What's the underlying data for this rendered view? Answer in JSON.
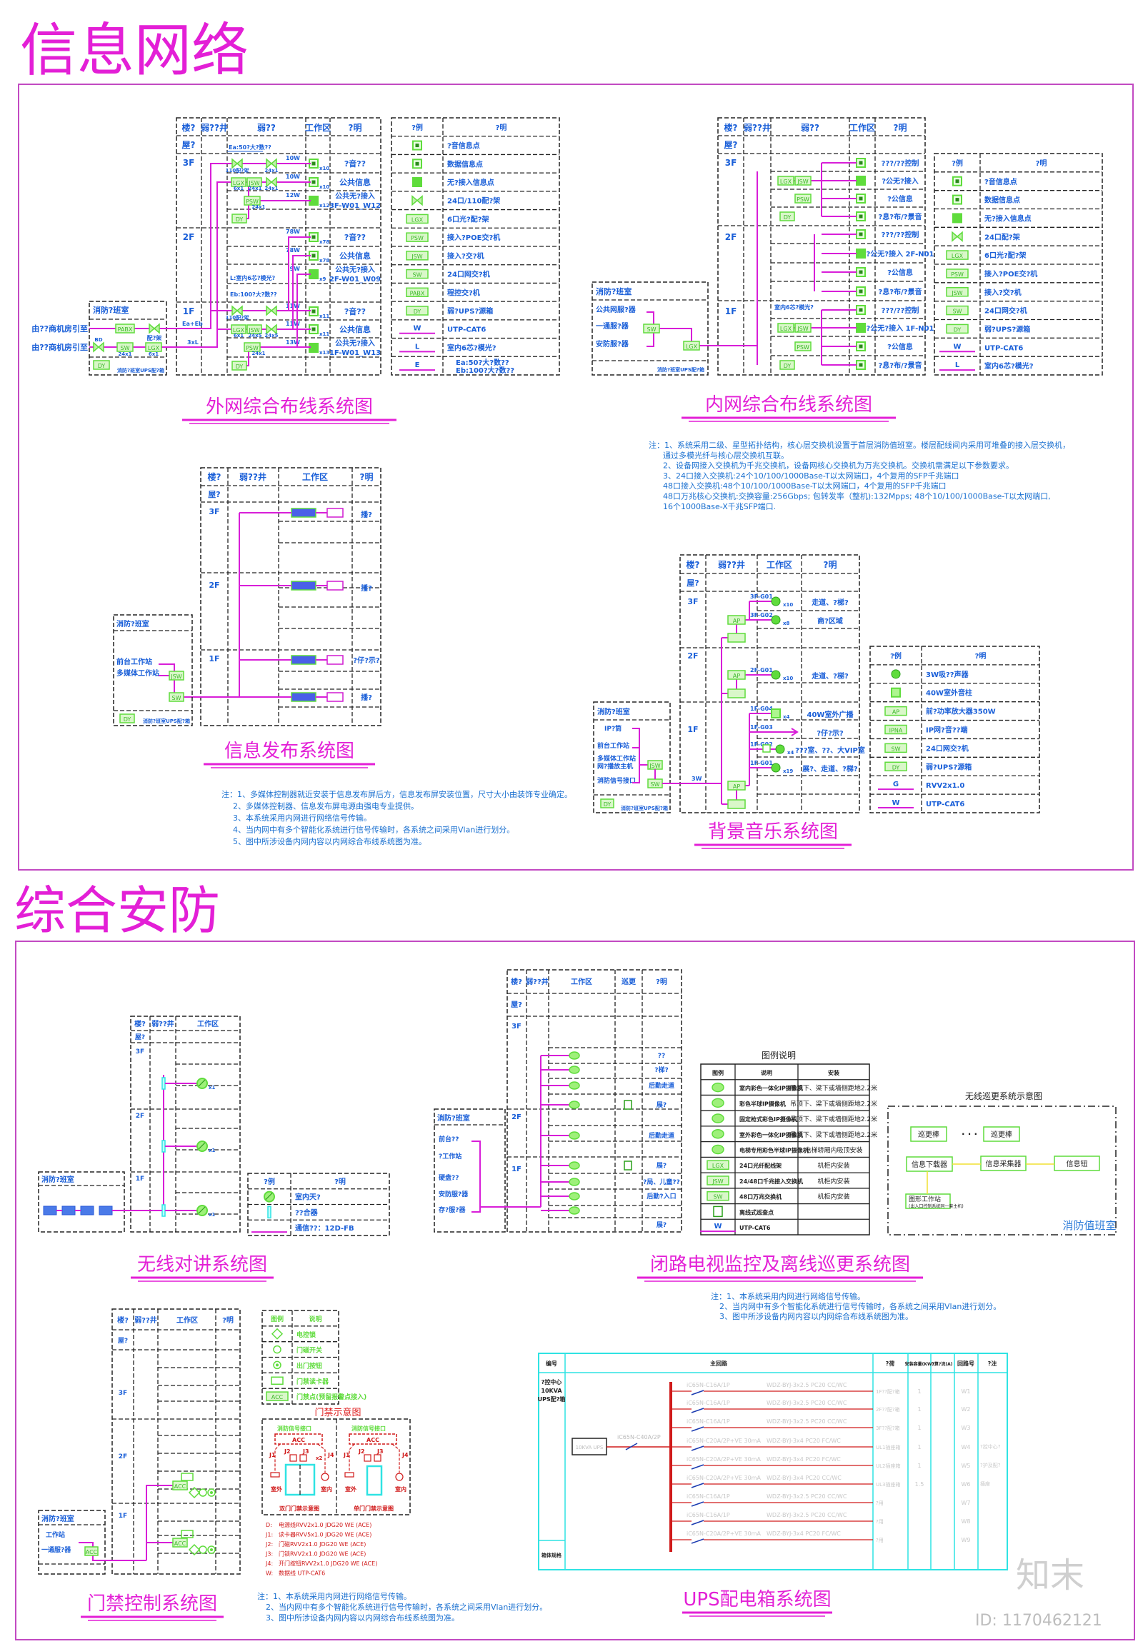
{
  "page": {
    "section1_title": "信息网络",
    "section2_title": "综合安防",
    "watermark_logo": "知末",
    "watermark_id": "ID: 1170462121"
  },
  "colors": {
    "title": "#e31fd6",
    "wire": "#d81ed8",
    "device": "#5fdc3c",
    "text": "#1a5fd8",
    "ups_bus": "#d01a1a",
    "frame": "#c24ac2"
  },
  "ext": {
    "title": "外网综合布线系统图",
    "headers": [
      "楼?",
      "弱??井",
      "弱??",
      "工作区",
      "?明"
    ],
    "floors": [
      "屋?",
      "3F",
      "2F",
      "1F"
    ],
    "desc": [
      "?音??",
      "公共信息",
      "公共无?接入",
      "3F-W01_W12",
      "?音??",
      "公共信息",
      "公共无?接入",
      "2F-W01_W09",
      "?音??",
      "公共信息",
      "公共无?接入",
      "1F-W01_W13"
    ],
    "counts": [
      "x10",
      "x10",
      "x12",
      "x78",
      "x78",
      "x9",
      "x11",
      "x11",
      "x13"
    ],
    "wires": [
      "10W",
      "10W",
      "12W",
      "78W",
      "78W",
      "9W",
      "11W",
      "11W",
      "13W"
    ],
    "room": "消防?班室",
    "ups_label": "消防?班室UPS配?箱",
    "inputs": [
      "由??商机房引至",
      "由??商机房引至"
    ],
    "cable_notes": [
      "Ea:50?大?数??",
      "L:室内6芯?模光?",
      "Eb:100?大?数??",
      "Ea+Eb",
      "3xL"
    ],
    "boxes": [
      "PABX",
      "SW",
      "LGX",
      "DY",
      "LGX",
      "JSW",
      "PSW",
      "DY",
      "LGX",
      "JSW",
      "PSW",
      "DY"
    ],
    "patch_labels": [
      "配?架",
      "BD",
      "110配?架",
      "110配?架"
    ],
    "ports": [
      "24x1",
      "6x1",
      "24x1",
      "6x1",
      "24x1",
      "24x1",
      "24x1",
      "6x1",
      "24x5",
      "24x5",
      "24x1"
    ],
    "legend": {
      "headers": [
        "?例",
        "?明"
      ],
      "items": [
        {
          "icon": "outlet",
          "label": "?音信息点"
        },
        {
          "icon": "outlet",
          "label": "数据信息点"
        },
        {
          "icon": "outlet-filled",
          "label": "无?接入信息点"
        },
        {
          "icon": "patch",
          "label": "24口/110配?架"
        },
        {
          "icon": "box",
          "code": "LGX",
          "label": "6口光?配?架"
        },
        {
          "icon": "box",
          "code": "PSW",
          "label": "接入?POE交?机"
        },
        {
          "icon": "box",
          "code": "JSW",
          "label": "接入?交?机"
        },
        {
          "icon": "box",
          "code": "SW",
          "label": "24口网交?机"
        },
        {
          "icon": "box",
          "code": "PABX",
          "label": "程控交?机"
        },
        {
          "icon": "box",
          "code": "DY",
          "label": "弱?UPS?源箱"
        },
        {
          "icon": "line",
          "code": "W",
          "label": "UTP-CAT6"
        },
        {
          "icon": "line",
          "code": "L",
          "label": "室内6芯?模光?"
        },
        {
          "icon": "line",
          "code": "E",
          "label": "Ea:50?大?数??",
          "label2": "Eb:100?大?数??"
        }
      ]
    }
  },
  "int": {
    "title": "内网综合布线系统图",
    "headers": [
      "楼?",
      "弱??井",
      "弱??",
      "工作区",
      "?明"
    ],
    "floors": [
      "屋?",
      "3F",
      "2F",
      "1F"
    ],
    "desc": [
      "???/??控制",
      "?公无?接入",
      "?公信息",
      "?息?布/?景音",
      "???/??控制",
      "?公无?接入 2F-N01",
      "?公信息",
      "?息?布/?景音",
      "???/??控制",
      "?公无?接入 1F-N01",
      "?公信息",
      "?息?布/?景音"
    ],
    "room": "消防?班室",
    "servers": [
      "公共网服?器",
      "一通服?器",
      "安防服?器"
    ],
    "ups_label": "消防?班室UPS配?箱",
    "boxes": [
      "LGX",
      "JSW",
      "PSW",
      "DY",
      "LGX",
      "JSW",
      "PSW",
      "DY",
      "SW",
      "LGX"
    ],
    "cable_note": "室内6芯?模光?",
    "legend": {
      "headers": [
        "?例",
        "?明"
      ],
      "items": [
        {
          "icon": "outlet",
          "label": "?音信息点"
        },
        {
          "icon": "outlet",
          "label": "数据信息点"
        },
        {
          "icon": "outlet-filled",
          "label": "无?接入信息点"
        },
        {
          "icon": "patch",
          "label": "24口配?架"
        },
        {
          "icon": "box",
          "code": "LGX",
          "label": "6口光?配?架"
        },
        {
          "icon": "box",
          "code": "PSW",
          "label": "接入?POE交?机"
        },
        {
          "icon": "box",
          "code": "JSW",
          "label": "接入?交?机"
        },
        {
          "icon": "box",
          "code": "SW",
          "label": "24口网交?机"
        },
        {
          "icon": "box",
          "code": "DY",
          "label": "弱?UPS?源箱"
        },
        {
          "icon": "line",
          "code": "W",
          "label": "UTP-CAT6"
        },
        {
          "icon": "line",
          "code": "L",
          "label": "室内6芯?模光?"
        }
      ]
    },
    "notes": [
      "注：1、系统采用二级、星型拓扑结构，核心层交换机设置于首层消防值班室。楼层配线间内采用可堆叠的接入层交换机，",
      "通过多模光纤与核心层交换机互联。",
      "2、设备网接入交换机为千兆交换机，设备网核心交换机为万兆交换机。交换机需满足以下参数要求。",
      "3、24口接入交换机:24个10/100/1000Base-T以太网端口，4个复用的SFP千兆端口",
      "48口接入交换机:48个10/100/1000Base-T以太网端口，4个复用的SFP千兆端口",
      "48口万兆核心交换机:交换容量:256Gbps; 包转发率（整机):132Mpps; 48个10/100/1000Base-T以太网端口,",
      "16个1000Base-X千兆SFP端口."
    ]
  },
  "pub": {
    "title": "信息发布系统图",
    "headers": [
      "楼?",
      "弱??井",
      "工作区",
      "?明"
    ],
    "floors": [
      "屋?",
      "3F",
      "2F",
      "1F"
    ],
    "desc": [
      "播?",
      "播?",
      "?仔?示?",
      "播?"
    ],
    "room": "消防?班室",
    "stations": [
      "前台工作站",
      "多媒体工作站"
    ],
    "ups_label": "消防?班室UPS配?箱",
    "boxes": [
      "JSW",
      "SW",
      "DY"
    ],
    "notes": [
      "注：1、多媒体控制器就近安装于信息发布屏后方，信息发布屏安装位置，尺寸大小由装饰专业确定。",
      "2、多媒体控制器、信息发布屏电源由强电专业提供。",
      "3、本系统采用内网进行网络信号传输。",
      "4、当内网中有多个智能化系统进行信号传输时，各系统之间采用Vlan进行划分。",
      "5、图中所涉设备内网内容以内网综合布线系统图为准。"
    ]
  },
  "music": {
    "title": "背景音乐系统图",
    "headers": [
      "楼?",
      "弱??井",
      "工作区",
      "?明"
    ],
    "floors": [
      "屋?",
      "3F",
      "2F",
      "1F"
    ],
    "zones": [
      "3F-G01",
      "3F-G02",
      "2F-G01",
      "1F-G04",
      "1F-G03",
      "1F-G02",
      "1F-G01"
    ],
    "counts": [
      "x10",
      "x8",
      "x10",
      "x4",
      "x4",
      "x19"
    ],
    "desc": [
      "走道、?梯?",
      "商?区域",
      "走道、?梯?",
      "40W室外广播",
      "?仔?示?",
      "???室、??、大VIP室",
      "展?、走道、?梯?"
    ],
    "room": "消防?班室",
    "sources": [
      "IP?筒",
      "前台工作站",
      "多媒体工作站",
      "网?播放主机",
      "消防信号接口"
    ],
    "ups_label": "消防?班室UPS配?箱",
    "boxes": [
      "JSW",
      "SW",
      "DY",
      "AP",
      "AP",
      "AP"
    ],
    "wire_note": "3W",
    "legend": {
      "headers": [
        "?例",
        "?明"
      ],
      "items": [
        {
          "icon": "speaker",
          "label": "3W吸??声器"
        },
        {
          "icon": "speaker-square",
          "label": "40W室外音柱"
        },
        {
          "icon": "box",
          "code": "AP",
          "label": "前?功率放大器350W"
        },
        {
          "icon": "box",
          "code": "IPNA",
          "label": "IP网?音??端"
        },
        {
          "icon": "box",
          "code": "SW",
          "label": "24口网交?机"
        },
        {
          "icon": "box",
          "code": "DY",
          "label": "弱?UPS?源箱"
        },
        {
          "icon": "line",
          "code": "G",
          "label": "RVV2x1.0"
        },
        {
          "icon": "line",
          "code": "W",
          "label": "UTP-CAT6"
        }
      ]
    }
  },
  "radio": {
    "title": "无线对讲系统图",
    "headers": [
      "楼?",
      "弱??井",
      "工作区"
    ],
    "floors": [
      "屋?",
      "3F",
      "2F",
      "1F"
    ],
    "counts": [
      "x1",
      "x1",
      "x1"
    ],
    "room": "消防?班室",
    "legend": {
      "headers": [
        "?例",
        "?明"
      ],
      "items": [
        {
          "icon": "antenna",
          "label": "室内天?"
        },
        {
          "icon": "splitter",
          "label": "??合器"
        },
        {
          "icon": "line",
          "code": "",
          "label": "通信??：12D-FB"
        }
      ]
    }
  },
  "cctv": {
    "title": "闭路电视监控及离线巡更系统图",
    "headers": [
      "楼?",
      "弱??井",
      "工作区",
      "巡更",
      "?明"
    ],
    "floors": [
      "屋?",
      "3F",
      "2F",
      "1F"
    ],
    "desc": [
      "??",
      "?梯?",
      "后勤走道",
      "展?",
      "后勤走道",
      "展?",
      "?局、儿童??",
      "后勤?入口",
      "展?"
    ],
    "room": "消防?班室",
    "devices": [
      "前台??",
      "?工作站",
      "硬盘??",
      "安防服?器",
      "存?服?器"
    ],
    "legend": {
      "title": "图例说明",
      "headers": [
        "图例",
        "说明",
        "安装"
      ],
      "items": [
        {
          "icon": "camera-dome",
          "label": "室内彩色一体化IP摄像机",
          "install": "吊顶下、梁下或墙侧距地2.2米"
        },
        {
          "icon": "camera-half",
          "label": "彩色半球IP摄像机",
          "install": "吊顶下、梁下或墙侧距地2.2米"
        },
        {
          "icon": "camera-bullet",
          "label": "固定枪式彩色IP摄像机",
          "install": "吊顶下、梁下或墙侧距地2.2米"
        },
        {
          "icon": "camera-outdoor",
          "label": "室外彩色一体化IP摄像机",
          "install": "吊顶下、梁下或墙侧距地2.2米"
        },
        {
          "icon": "camera-half",
          "label": "电梯专用彩色半球IP摄像机",
          "install": "电梯轿厢内吸顶安装"
        },
        {
          "icon": "box",
          "code": "LGX",
          "label": "24口光纤配线架",
          "install": "机柜内安装"
        },
        {
          "icon": "box",
          "code": "JSW",
          "label": "24/48口千兆接入交换机",
          "install": "机柜内安装"
        },
        {
          "icon": "box",
          "code": "SW",
          "label": "48口万兆交换机",
          "install": "机柜内安装"
        },
        {
          "icon": "patrol-point",
          "label": "离线式巡查点",
          "install": ""
        },
        {
          "icon": "line",
          "code": "W",
          "label": "UTP-CAT6",
          "install": ""
        }
      ]
    },
    "patrol": {
      "title": "无线巡更系统示意图",
      "stick": "巡更棒",
      "dots": "· · ·",
      "downloader": "信息下载器",
      "collector": "信息采集器",
      "button": "信息钮",
      "workstation": "图形工作站",
      "workstation_note": "(出入口控制系统同一套主机)",
      "room": "消防值班室"
    },
    "notes": [
      "注：1、本系统采用内网进行网络信号传输。",
      "2、当内网中有多个智能化系统进行信号传输时，各系统之间采用Vlan进行划分。",
      "3、图中所涉设备内网内容以内网综合布线系统图为准。"
    ]
  },
  "access": {
    "title": "门禁控制系统图",
    "headers": [
      "楼?",
      "弱??井",
      "工作区",
      "?明"
    ],
    "floors": [
      "屋?",
      "3F",
      "2F",
      "1F"
    ],
    "room": "消防?班室",
    "devices": [
      "工作站",
      "一通服?器"
    ],
    "boxes": [
      "ACC",
      "ACC"
    ],
    "legend": {
      "headers": [
        "图例",
        "说明"
      ],
      "items": [
        {
          "icon": "lock",
          "label": "电控锁"
        },
        {
          "icon": "door-switch",
          "label": "门磁开关"
        },
        {
          "icon": "exit-button",
          "label": "出门按钮"
        },
        {
          "icon": "card-reader",
          "label": "门禁读卡器"
        },
        {
          "icon": "box",
          "code": "ACC",
          "label": "门禁点(预留报警点接入)"
        }
      ]
    },
    "door": {
      "title": "门禁示意图",
      "fire_interface": "消防信号接口",
      "acc": "ACC",
      "ports": [
        "J1",
        "J2",
        "J3",
        "J4"
      ],
      "lock_marks": [
        "M",
        "L"
      ],
      "x2": "x2",
      "outside": "室外",
      "inside": "室内",
      "double_caption": "双门门禁示意图",
      "single_caption": "单门门禁示意图"
    },
    "cables": [
      {
        "code": "D:",
        "text": "电源线RVV2x1.0 JDG20 WE (ACE)"
      },
      {
        "code": "J1:",
        "text": "读卡器RVV5x1.0 JDG20 WE (ACE)"
      },
      {
        "code": "J2:",
        "text": "门磁RVV2x1.0 JDG20 WE (ACE)"
      },
      {
        "code": "J3:",
        "text": "门锁RVV2x1.0 JDG20 WE (ACE)"
      },
      {
        "code": "J4:",
        "text": "开门按钮RVV2x1.0 JDG20 WE (ACE)"
      },
      {
        "code": "W:",
        "text": "数据线 UTP-CAT6"
      }
    ],
    "notes": [
      "注：1、本系统采用内网进行网络信号传输。",
      "2、当内网中有多个智能化系统进行信号传输时，各系统之间采用Vlan进行划分。",
      "3、图中所涉设备内网内容以内网综合布线系统图为准。"
    ]
  },
  "ups": {
    "title": "UPS配电箱系统图",
    "headers": [
      "编号",
      "主回路",
      "?荷",
      "安装容量(KW)",
      "?算?流(A)",
      "回路号",
      "?注"
    ],
    "box_name": [
      "?控中心",
      "10KVA",
      "UPS配?箱"
    ],
    "box_footer": "箱体规格",
    "ups_unit": "10KVA UPS",
    "main_breaker": "iC65N-C40A/2P",
    "circuits": [
      {
        "breaker": "iC65N-C16A/1P",
        "cable": "WDZ-BYJ-3x2.5 PC20 CC/WC",
        "load": "1F??配?箱",
        "kw": "1",
        "no": "W1"
      },
      {
        "breaker": "iC65N-C16A/1P",
        "cable": "WDZ-BYJ-3x2.5 PC20 CC/WC",
        "load": "2F??配?箱",
        "kw": "1",
        "no": "W2"
      },
      {
        "breaker": "iC65N-C16A/1P",
        "cable": "WDZ-BYJ-3x2.5 PC20 CC/WC",
        "load": "3F??配?箱",
        "kw": "1",
        "no": "W3"
      },
      {
        "breaker": "iC65N-C20A/2P+VE 30mA",
        "cable": "WDZ-BYJ-3x4 PC20 FC/WC",
        "load": "UL1插座箱",
        "kw": "1",
        "no": "W4"
      },
      {
        "breaker": "iC65N-C20A/2P+VE 30mA",
        "cable": "WDZ-BYJ-3x4 PC20 FC/WC",
        "load": "UL2插座箱",
        "kw": "1",
        "no": "W5"
      },
      {
        "breaker": "iC65N-C20A/2P+VE 30mA",
        "cable": "WDZ-BYJ-3x4 PC20 CC/WC",
        "load": "UL3插座箱",
        "kw": "1.5",
        "no": "W6"
      },
      {
        "breaker": "iC65N-C16A/1P",
        "cable": "WDZ-BYJ-3x2.5 PC20 CC/WC",
        "load": "?用",
        "kw": "",
        "no": "W7"
      },
      {
        "breaker": "iC65N-C16A/1P",
        "cable": "WDZ-BYJ-3x2.5 PC20 CC/WC",
        "load": "?用",
        "kw": "",
        "no": "W8"
      },
      {
        "breaker": "iC65N-C20A/2P+VE 30mA",
        "cable": "WDZ-BYJ-3x4 PC20 FC/WC",
        "load": "?用",
        "kw": "",
        "no": "W9"
      }
    ],
    "remarks": [
      "?控中心?",
      "?护及配?",
      "插座"
    ]
  }
}
